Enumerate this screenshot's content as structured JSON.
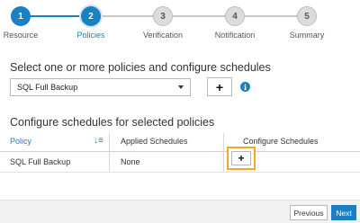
{
  "wizard": {
    "steps": [
      {
        "number": "1",
        "label": "Resource",
        "state": "done"
      },
      {
        "number": "2",
        "label": "Policies",
        "state": "active"
      },
      {
        "number": "3",
        "label": "Verification",
        "state": "pending"
      },
      {
        "number": "4",
        "label": "Notification",
        "state": "pending"
      },
      {
        "number": "5",
        "label": "Summary",
        "state": "pending"
      }
    ]
  },
  "policy_selection": {
    "heading": "Select one or more policies and configure schedules",
    "selected_policy": "SQL Full Backup",
    "add_button_label": "+"
  },
  "schedules": {
    "heading": "Configure schedules for selected policies",
    "columns": [
      "Policy",
      "Applied Schedules",
      "Configure Schedules"
    ],
    "rows": [
      {
        "policy": "SQL Full Backup",
        "applied": "None",
        "configure_label": "+"
      }
    ]
  },
  "footer": {
    "previous_label": "Previous",
    "next_label": "Next"
  },
  "colors": {
    "accent": "#1b7fc4",
    "highlight": "#f5a623"
  }
}
